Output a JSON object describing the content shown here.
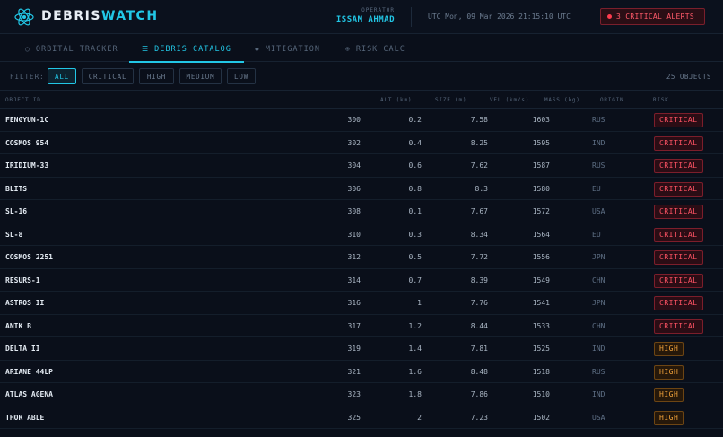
{
  "app": {
    "brand_part1": "DEBRIS",
    "brand_part2": "WATCH"
  },
  "operator": {
    "label": "OPERATOR",
    "name": "ISSAM AHMAD"
  },
  "clock": "UTC Mon, 09 Mar 2026 21:15:10 UTC",
  "alerts": {
    "label": "3 CRITICAL ALERTS"
  },
  "tabs": [
    {
      "label": "ORBITAL TRACKER",
      "icon": "globe-icon",
      "glyph": "○"
    },
    {
      "label": "DEBRIS CATALOG",
      "icon": "list-icon",
      "glyph": "☰"
    },
    {
      "label": "MITIGATION",
      "icon": "diamond-icon",
      "glyph": "◆"
    },
    {
      "label": "RISK CALC",
      "icon": "target-icon",
      "glyph": "⊕"
    }
  ],
  "filter": {
    "label": "FILTER:",
    "chips": [
      "ALL",
      "CRITICAL",
      "HIGH",
      "MEDIUM",
      "LOW"
    ],
    "active": "ALL",
    "count": "25 OBJECTS"
  },
  "columns": [
    "OBJECT ID",
    "ALT (km)",
    "SIZE (m)",
    "VEL (km/s)",
    "MASS (kg)",
    "ORIGIN",
    "RISK"
  ],
  "rows": [
    {
      "id": "FENGYUN-1C",
      "alt": "300",
      "size": "0.2",
      "vel": "7.58",
      "mass": "1603",
      "origin": "RUS",
      "risk": "CRITICAL"
    },
    {
      "id": "COSMOS 954",
      "alt": "302",
      "size": "0.4",
      "vel": "8.25",
      "mass": "1595",
      "origin": "IND",
      "risk": "CRITICAL"
    },
    {
      "id": "IRIDIUM-33",
      "alt": "304",
      "size": "0.6",
      "vel": "7.62",
      "mass": "1587",
      "origin": "RUS",
      "risk": "CRITICAL"
    },
    {
      "id": "BLITS",
      "alt": "306",
      "size": "0.8",
      "vel": "8.3",
      "mass": "1580",
      "origin": "EU",
      "risk": "CRITICAL"
    },
    {
      "id": "SL-16",
      "alt": "308",
      "size": "0.1",
      "vel": "7.67",
      "mass": "1572",
      "origin": "USA",
      "risk": "CRITICAL"
    },
    {
      "id": "SL-8",
      "alt": "310",
      "size": "0.3",
      "vel": "8.34",
      "mass": "1564",
      "origin": "EU",
      "risk": "CRITICAL"
    },
    {
      "id": "COSMOS 2251",
      "alt": "312",
      "size": "0.5",
      "vel": "7.72",
      "mass": "1556",
      "origin": "JPN",
      "risk": "CRITICAL"
    },
    {
      "id": "RESURS-1",
      "alt": "314",
      "size": "0.7",
      "vel": "8.39",
      "mass": "1549",
      "origin": "CHN",
      "risk": "CRITICAL"
    },
    {
      "id": "ASTROS II",
      "alt": "316",
      "size": "1",
      "vel": "7.76",
      "mass": "1541",
      "origin": "JPN",
      "risk": "CRITICAL"
    },
    {
      "id": "ANIK B",
      "alt": "317",
      "size": "1.2",
      "vel": "8.44",
      "mass": "1533",
      "origin": "CHN",
      "risk": "CRITICAL"
    },
    {
      "id": "DELTA II",
      "alt": "319",
      "size": "1.4",
      "vel": "7.81",
      "mass": "1525",
      "origin": "IND",
      "risk": "HIGH"
    },
    {
      "id": "ARIANE 44LP",
      "alt": "321",
      "size": "1.6",
      "vel": "8.48",
      "mass": "1518",
      "origin": "RUS",
      "risk": "HIGH"
    },
    {
      "id": "ATLAS AGENA",
      "alt": "323",
      "size": "1.8",
      "vel": "7.86",
      "mass": "1510",
      "origin": "IND",
      "risk": "HIGH"
    },
    {
      "id": "THOR ABLE",
      "alt": "325",
      "size": "2",
      "vel": "7.23",
      "mass": "1502",
      "origin": "USA",
      "risk": "HIGH"
    }
  ],
  "colors": {
    "accent": "#22c7e6",
    "critical": "#ff5364",
    "high": "#f1a23a",
    "background": "#0a0f1a"
  }
}
